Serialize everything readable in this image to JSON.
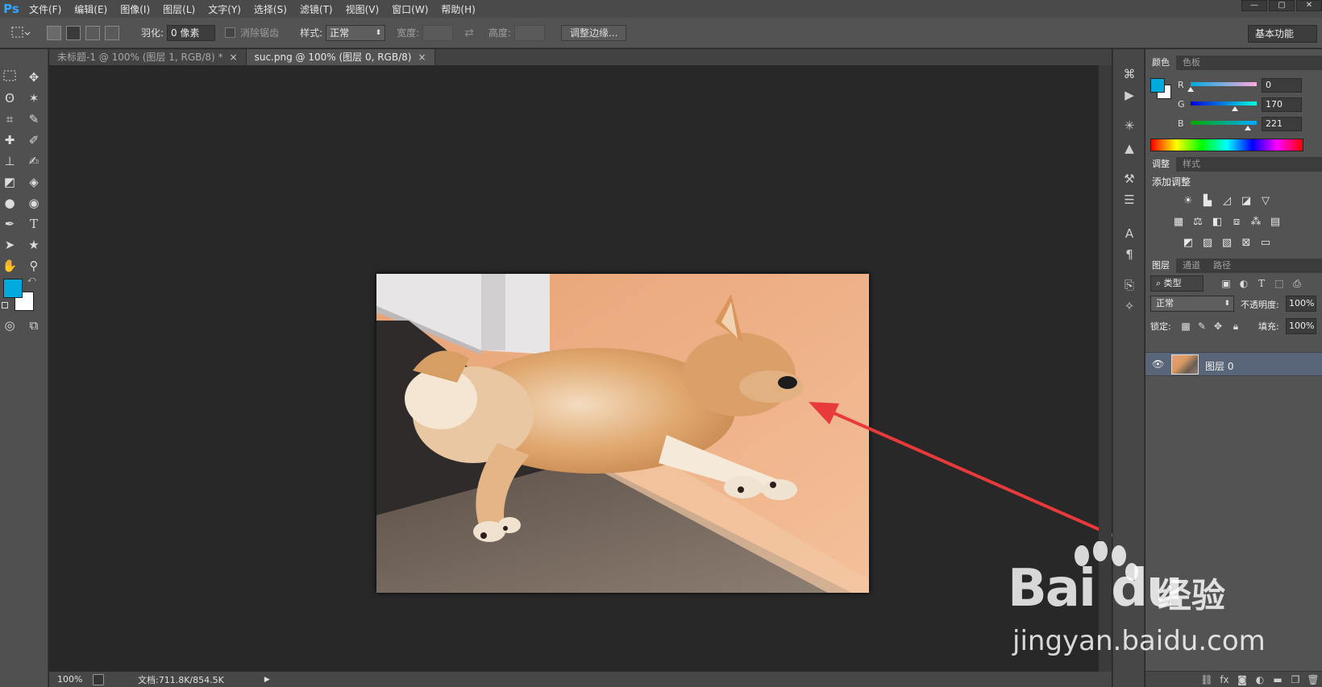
{
  "menubar": {
    "logo": "Ps",
    "items": [
      "文件(F)",
      "编辑(E)",
      "图像(I)",
      "图层(L)",
      "文字(Y)",
      "选择(S)",
      "滤镜(T)",
      "视图(V)",
      "窗口(W)",
      "帮助(H)"
    ],
    "window_controls": [
      "—",
      "▢",
      "✕"
    ]
  },
  "options": {
    "feather_label": "羽化:",
    "feather_value": "0 像素",
    "antialias_label": "消除锯齿",
    "style_label": "样式:",
    "style_value": "正常",
    "width_label": "宽度:",
    "height_label": "高度:",
    "refine_button": "调整边缘...",
    "workspace": "基本功能"
  },
  "tabs": [
    {
      "label": "未标题-1 @ 100% (图层 1, RGB/8) *",
      "close": "×"
    },
    {
      "label": "suc.png @ 100% (图层 0, RGB/8)",
      "close": "×"
    }
  ],
  "status": {
    "zoom": "100%",
    "doc_info": "文档:711.8K/854.5K"
  },
  "color_panel": {
    "tabs": [
      "颜色",
      "色板"
    ],
    "r_label": "R",
    "g_label": "G",
    "b_label": "B",
    "r_value": "0",
    "g_value": "170",
    "b_value": "221",
    "r_frac": 0.0,
    "g_frac": 0.667,
    "b_frac": 0.867,
    "foreground": "#00aadd",
    "background": "#ffffff"
  },
  "adjust_panel": {
    "tabs": [
      "调整",
      "样式"
    ],
    "title": "添加调整"
  },
  "layers_panel": {
    "tabs": [
      "图层",
      "通道",
      "路径"
    ],
    "filter_label": "类型",
    "blend_mode": "正常",
    "opacity_label": "不透明度:",
    "opacity_value": "100%",
    "lock_label": "锁定:",
    "fill_label": "填充:",
    "fill_value": "100%",
    "layer_name": "图层 0"
  },
  "watermark": {
    "logo": "Bai du",
    "brand": "经验",
    "url": "jingyan.baidu.com"
  },
  "colors": {
    "accent_arrow": "#e83a3a",
    "selected_layer": "#596578"
  }
}
